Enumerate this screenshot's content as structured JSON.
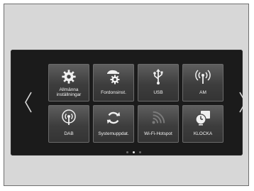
{
  "tiles": [
    {
      "label": "Allmänna\ninställningar",
      "icon": "settings-gear-icon"
    },
    {
      "label": "Fordonsinst.",
      "icon": "vehicle-settings-icon"
    },
    {
      "label": "USB",
      "icon": "usb-icon"
    },
    {
      "label": "AM",
      "icon": "am-radio-antenna-icon"
    },
    {
      "label": "DAB",
      "icon": "dab-radio-antenna-icon"
    },
    {
      "label": "Systemuppdat.",
      "icon": "system-update-icon"
    },
    {
      "label": "Wi-Fi-Hotspot",
      "icon": "wifi-hotspot-icon"
    },
    {
      "label": "KLOCKA",
      "icon": "clock-icon"
    }
  ],
  "pager": {
    "count": 3,
    "active": 1
  },
  "colors": {
    "tile_text": "#f2f2f2",
    "screen_bg": "#1b1b1b",
    "inactive_icon": "#7a7a7a"
  }
}
